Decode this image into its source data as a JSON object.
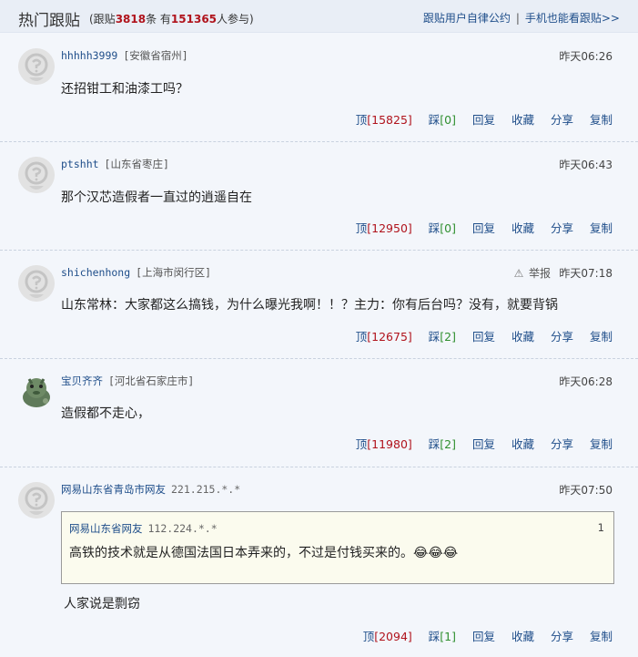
{
  "header": {
    "title": "热门跟贴",
    "stats_prefix": "(跟贴",
    "post_count": "3818",
    "stats_mid": "条 有",
    "participant_count": "151365",
    "stats_suffix": "人参与)",
    "link_rules": "跟贴用户自律公约",
    "link_separator": "|",
    "link_mobile": "手机也能看跟贴>>"
  },
  "actions_labels": {
    "up": "顶",
    "down": "踩",
    "reply": "回复",
    "favorite": "收藏",
    "share": "分享",
    "copy": "复制",
    "report": "举报"
  },
  "posts": [
    {
      "user": "hhhhh3999",
      "location": "[安徽省宿州]",
      "time": "昨天06:26",
      "content": "还招钳工和油漆工吗？",
      "up": "[15825]",
      "down": "[0]"
    },
    {
      "user": "ptshht",
      "location": "[山东省枣庄]",
      "time": "昨天06:43",
      "content": "那个汉芯造假者一直过的逍遥自在",
      "up": "[12950]",
      "down": "[0]"
    },
    {
      "user": "shichenhong",
      "location": "[上海市闵行区]",
      "time": "昨天07:18",
      "content": "山东常林：大家都这么搞钱，为什么曝光我啊！！？主力：你有后台吗？没有，就要背锅",
      "up": "[12675]",
      "down": "[2]"
    },
    {
      "user": "宝贝齐齐",
      "location": "[河北省石家庄市]",
      "time": "昨天06:28",
      "content": "造假都不走心，",
      "up": "[11980]",
      "down": "[2]"
    },
    {
      "user": "网易山东省青岛市网友",
      "ip": "221.215.*.*",
      "time": "昨天07:50",
      "quote": {
        "user": "网易山东省网友",
        "ip": "112.224.*.*",
        "floor": "1",
        "content": "高铁的技术就是从德国法国日本弄来的，不过是付钱买来的。😂😂😂"
      },
      "content": "人家说是剽窃",
      "up": "[2094]",
      "down": "[1]"
    }
  ]
}
